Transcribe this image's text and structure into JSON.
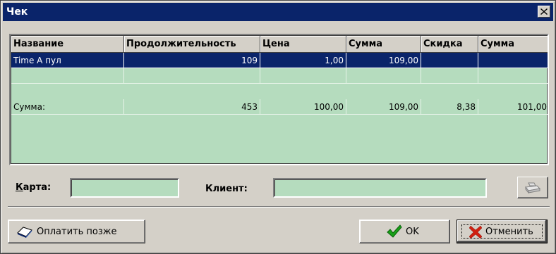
{
  "window": {
    "title": "Чек"
  },
  "grid": {
    "columns": [
      "Название",
      "Продолжительность",
      "Цена",
      "Сумма",
      "Скидка",
      "Сумма"
    ],
    "rows": [
      {
        "name": "Time A пул",
        "duration": "109",
        "price": "1,00",
        "sum": "109,00",
        "discount": "",
        "total": ""
      },
      {
        "name": "",
        "duration": "",
        "price": "",
        "sum": "",
        "discount": "",
        "total": ""
      },
      {
        "name": "Сумма:",
        "duration": "453",
        "price": "100,00",
        "sum": "109,00",
        "discount": "8,38",
        "total": "101,00"
      }
    ],
    "selected_row_color": "#0a246a",
    "background_color": "#b5dcbe"
  },
  "card": {
    "label_underlined": "К",
    "label_rest": "арта:",
    "value": ""
  },
  "client": {
    "label": "Клиент:",
    "value": ""
  },
  "buttons": {
    "pay_later": "Оплатить позже",
    "ok": "OK",
    "cancel": "Отменить"
  },
  "icons": {
    "pay_later": "eraser-icon",
    "ok": "green-checkmark-icon",
    "cancel": "red-x-icon",
    "print": "printer-icon",
    "close": "close-icon"
  }
}
